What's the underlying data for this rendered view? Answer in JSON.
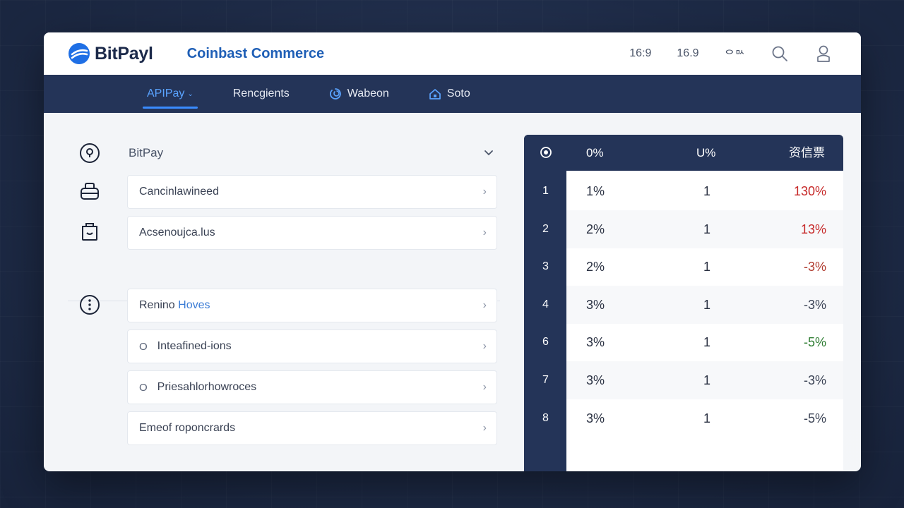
{
  "header": {
    "brand_name": "BitPayl",
    "product_name": "Coinbast Commerce",
    "right_items": [
      "16:9",
      "16.9",
      "ᄋᄆᄉ"
    ]
  },
  "nav": {
    "tabs": [
      {
        "label": "APIPay",
        "active": true
      },
      {
        "label": "Rencgients",
        "active": false
      },
      {
        "label": "Wabeon",
        "active": false
      },
      {
        "label": "Soto",
        "active": false
      }
    ]
  },
  "left_panel": {
    "select_value": "BitPay",
    "group1": [
      "Cancinlawineed",
      "Acsenoujca.lus"
    ],
    "group2": {
      "row1_prefix": "Renino",
      "row1_highlight": "Hoves",
      "row2": "Inteafined-ions",
      "row3": "Priesahlorhowroces",
      "row4": "Emeof roponcrards"
    }
  },
  "table": {
    "headers": [
      "0%",
      "U%",
      "资信票"
    ],
    "rows": [
      {
        "num": "1",
        "a": "1%",
        "b": "1",
        "c": "130%",
        "tone": "red"
      },
      {
        "num": "2",
        "a": "2%",
        "b": "1",
        "c": "13%",
        "tone": "red"
      },
      {
        "num": "3",
        "a": "2%",
        "b": "1",
        "c": "-3%",
        "tone": "darkred"
      },
      {
        "num": "4",
        "a": "3%",
        "b": "1",
        "c": "-3%",
        "tone": "gray"
      },
      {
        "num": "6",
        "a": "3%",
        "b": "1",
        "c": "-5%",
        "tone": "green"
      },
      {
        "num": "7",
        "a": "3%",
        "b": "1",
        "c": "-3%",
        "tone": "gray"
      },
      {
        "num": "8",
        "a": "3%",
        "b": "1",
        "c": "-5%",
        "tone": "gray"
      }
    ]
  },
  "colors": {
    "accent": "#1f5fb6",
    "nav_bg": "#243458",
    "positive": "#c62828",
    "negative": "#2e7d32"
  }
}
